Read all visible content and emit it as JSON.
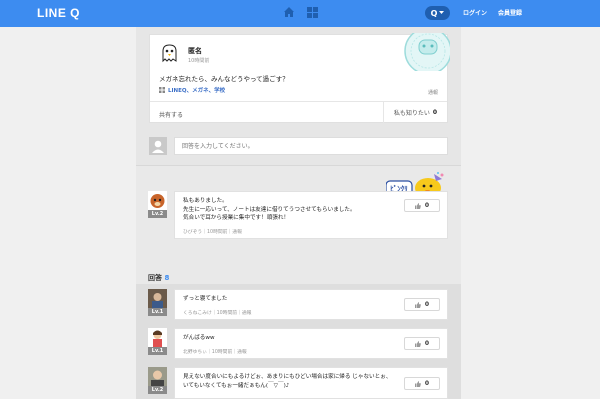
{
  "header": {
    "logo": "LINE Q",
    "q_button": "Q",
    "login": "ログイン",
    "register": "会員登録"
  },
  "question": {
    "author": "匿名",
    "time": "10時間前",
    "text": "メガネ忘れたら、みんなどうやって過ごす？",
    "tags": "LINEQ、メガネ、学校",
    "report": "通報",
    "share": "共有する",
    "want_know_label": "私も知りたい",
    "want_know_count": "0"
  },
  "answer_input": {
    "placeholder": "回答を入力してください。"
  },
  "top_comment": {
    "level": "Lv.2",
    "line1": "私もありました。",
    "line2": "先生に一応いって、ノートは友達に借りてうつさせてもらいました。",
    "line3": "気合いで耳から授業に集中です！頑張れ！",
    "meta": "ひびぞう｜10時間前｜通報",
    "likes": "0"
  },
  "answers_header": {
    "label": "回答",
    "count": "8"
  },
  "answers": [
    {
      "level": "Lv.1",
      "text": "ずっと寝てました",
      "meta": "くろねこみけ｜10時間前｜通報",
      "likes": "0"
    },
    {
      "level": "Lv.1",
      "text": "がんばるww",
      "meta": "北野ゆちぃ｜10時間前｜通報",
      "likes": "0"
    },
    {
      "level": "Lv.2",
      "text": "見えない度合いにもよるけどぉ、あまりにもひどい場合は家に帰る じゃないとぉ、いてもいなくてもぉ一緒だぁもん(￣▽￣)♪",
      "meta": "",
      "likes": "0"
    }
  ],
  "colors": {
    "header": "#3d8cf0",
    "accent_dark": "#1f5fb0",
    "link": "#3d70c7",
    "sticker_yellow": "#f7c91c"
  }
}
